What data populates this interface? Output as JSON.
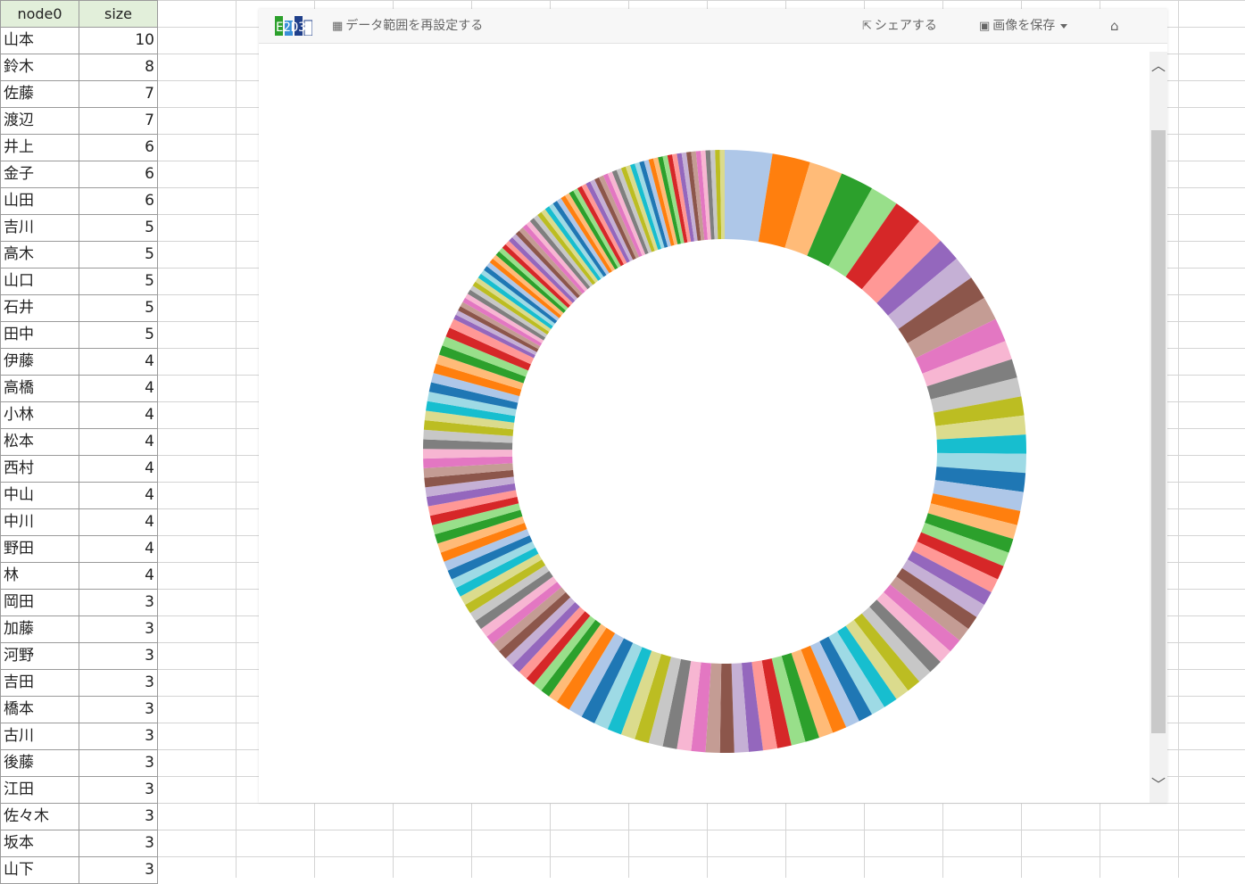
{
  "sheet": {
    "headers": [
      "node0",
      "size"
    ],
    "rows": [
      [
        "山本",
        "10"
      ],
      [
        "鈴木",
        "8"
      ],
      [
        "佐藤",
        "7"
      ],
      [
        "渡辺",
        "7"
      ],
      [
        "井上",
        "6"
      ],
      [
        "金子",
        "6"
      ],
      [
        "山田",
        "6"
      ],
      [
        "吉川",
        "5"
      ],
      [
        "高木",
        "5"
      ],
      [
        "山口",
        "5"
      ],
      [
        "石井",
        "5"
      ],
      [
        "田中",
        "5"
      ],
      [
        "伊藤",
        "4"
      ],
      [
        "高橋",
        "4"
      ],
      [
        "小林",
        "4"
      ],
      [
        "松本",
        "4"
      ],
      [
        "西村",
        "4"
      ],
      [
        "中山",
        "4"
      ],
      [
        "中川",
        "4"
      ],
      [
        "野田",
        "4"
      ],
      [
        "林",
        "4"
      ],
      [
        "岡田",
        "3"
      ],
      [
        "加藤",
        "3"
      ],
      [
        "河野",
        "3"
      ],
      [
        "吉田",
        "3"
      ],
      [
        "橋本",
        "3"
      ],
      [
        "古川",
        "3"
      ],
      [
        "後藤",
        "3"
      ],
      [
        "江田",
        "3"
      ],
      [
        "佐々木",
        "3"
      ],
      [
        "坂本",
        "3"
      ],
      [
        "山下",
        "3"
      ]
    ]
  },
  "app": {
    "logo_text": "E2D3",
    "reset_range_label": "データ範囲を再設定する",
    "share_label": "シェアする",
    "save_image_label": "画像を保存",
    "icons": {
      "table": "table-icon",
      "share": "share-icon",
      "image": "image-icon",
      "home": "home-icon"
    }
  },
  "chart_data": {
    "type": "pie",
    "donut": true,
    "sort": "descending",
    "note_visible_only": "Leading slices correspond to the visible sheet rows; the ring contains many more thin slices from rows below the visible area.",
    "labels": [
      "山本",
      "鈴木",
      "佐藤",
      "渡辺",
      "井上",
      "金子",
      "山田",
      "吉川",
      "高木",
      "山口",
      "石井",
      "田中",
      "伊藤",
      "高橋",
      "小林",
      "松本",
      "西村",
      "中山",
      "中川",
      "野田",
      "林",
      "岡田",
      "加藤",
      "河野",
      "吉田",
      "橋本",
      "古川",
      "後藤",
      "江田",
      "佐々木",
      "坂本",
      "山下"
    ],
    "values": [
      10,
      8,
      7,
      7,
      6,
      6,
      6,
      5,
      5,
      5,
      5,
      5,
      4,
      4,
      4,
      4,
      4,
      4,
      4,
      4,
      4,
      3,
      3,
      3,
      3,
      3,
      3,
      3,
      3,
      3,
      3,
      3
    ],
    "tail_values": {
      "count_of_3": 30,
      "count_of_2": 45,
      "count_of_1": 70
    },
    "palette": [
      "#aec7e8",
      "#ff7f0e",
      "#ffbb78",
      "#2ca02c",
      "#98df8a",
      "#d62728",
      "#ff9896",
      "#9467bd",
      "#c5b0d5",
      "#8c564b",
      "#c49c94",
      "#e377c2",
      "#f7b6d2",
      "#7f7f7f",
      "#c7c7c7",
      "#bcbd22",
      "#dbdb8d",
      "#17becf",
      "#9edae5",
      "#1f77b4"
    ]
  }
}
